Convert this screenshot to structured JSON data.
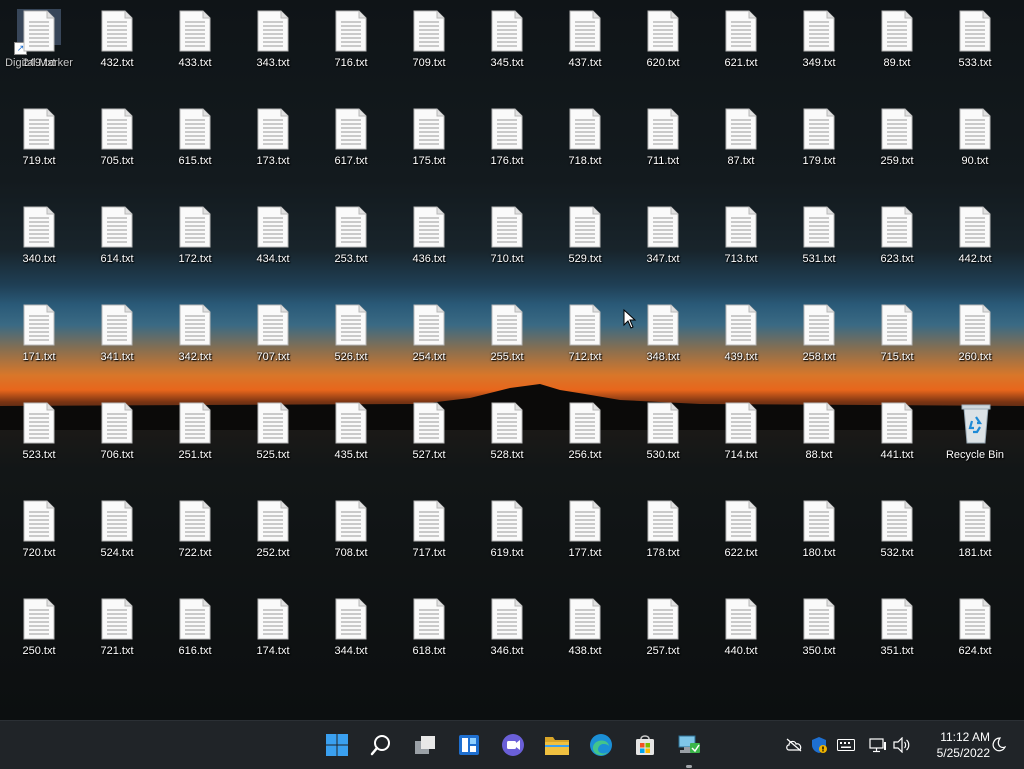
{
  "desktop": {
    "shortcut_label": "Digital Marker",
    "recycle_bin_label": "Recycle Bin",
    "files": [
      [
        "249.txt",
        "432.txt",
        "433.txt",
        "343.txt",
        "716.txt",
        "709.txt",
        "345.txt",
        "437.txt",
        "620.txt",
        "621.txt",
        "349.txt",
        "89.txt",
        "533.txt"
      ],
      [
        "719.txt",
        "705.txt",
        "615.txt",
        "173.txt",
        "617.txt",
        "175.txt",
        "176.txt",
        "718.txt",
        "711.txt",
        "87.txt",
        "179.txt",
        "259.txt",
        "90.txt"
      ],
      [
        "340.txt",
        "614.txt",
        "172.txt",
        "434.txt",
        "253.txt",
        "436.txt",
        "710.txt",
        "529.txt",
        "347.txt",
        "713.txt",
        "531.txt",
        "623.txt",
        "442.txt"
      ],
      [
        "171.txt",
        "341.txt",
        "342.txt",
        "707.txt",
        "526.txt",
        "254.txt",
        "255.txt",
        "712.txt",
        "348.txt",
        "439.txt",
        "258.txt",
        "715.txt",
        "260.txt"
      ],
      [
        "523.txt",
        "706.txt",
        "251.txt",
        "525.txt",
        "435.txt",
        "527.txt",
        "528.txt",
        "256.txt",
        "530.txt",
        "714.txt",
        "88.txt",
        "441.txt",
        null
      ],
      [
        "720.txt",
        "524.txt",
        "722.txt",
        "252.txt",
        "708.txt",
        "717.txt",
        "619.txt",
        "177.txt",
        "178.txt",
        "622.txt",
        "180.txt",
        "532.txt",
        "181.txt"
      ],
      [
        "250.txt",
        "721.txt",
        "616.txt",
        "174.txt",
        "344.txt",
        "618.txt",
        "346.txt",
        "438.txt",
        "257.txt",
        "440.txt",
        "350.txt",
        "351.txt",
        "624.txt"
      ]
    ]
  },
  "taskbar": {
    "pinned": [
      "start",
      "search",
      "task-view",
      "widgets",
      "chat",
      "file-explorer",
      "edge",
      "store",
      "network-app"
    ],
    "clock_time": "11:12 AM",
    "clock_date": "5/25/2022"
  },
  "colors": {
    "taskbar_bg": "#202428",
    "accent_blue": "#3aa0f0",
    "folder_yellow": "#f0c040"
  }
}
